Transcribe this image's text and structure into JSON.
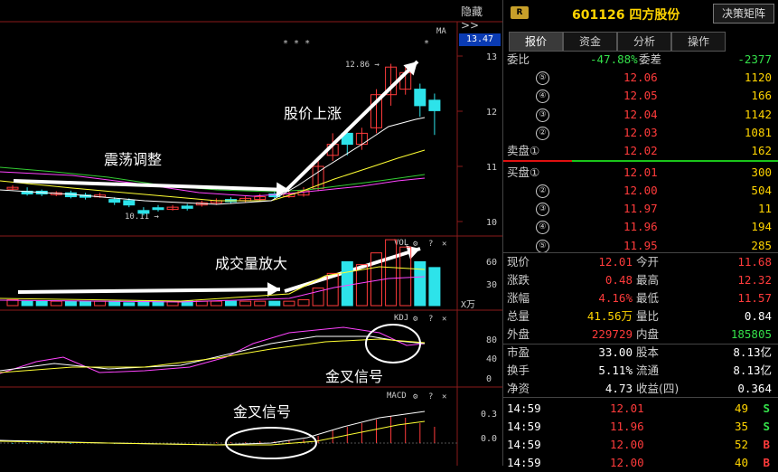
{
  "chart": {
    "hide_label": "隐藏>>",
    "ma_label": "MA",
    "price_tag": "13.47",
    "price_axis": [
      "13",
      "12",
      "11",
      "10"
    ],
    "high_label": "12.86",
    "low_label": "10.11",
    "stars": "* * *",
    "star_right": "*",
    "vol_label": "VOL",
    "vol_axis": [
      "60",
      "30"
    ],
    "vol_unit": "X万",
    "kdj_label": "KDJ",
    "kdj_axis": [
      "80",
      "40",
      "0"
    ],
    "macd_label": "MACD",
    "macd_axis": [
      "0.3",
      "0.0"
    ],
    "annotations": {
      "oscillation": "震荡调整",
      "rise": "股价上涨",
      "volume": "成交量放大",
      "golden_cross_kdj": "金叉信号",
      "golden_cross_macd": "金叉信号"
    },
    "colors": {
      "up": "#ff3b3b",
      "down": "#2de3ea",
      "ma5": "#ffffff",
      "ma10": "#ffff33",
      "ma20": "#ff44ff",
      "ma60": "#33cc33"
    }
  },
  "header": {
    "badge": "R",
    "code_name": "601126 四方股份",
    "decision_button": "决策矩阵"
  },
  "tabs": [
    "报价",
    "资金",
    "分析",
    "操作"
  ],
  "order_book": {
    "weibi_label": "委比",
    "weibi_value": "-47.88%",
    "weicha_label": "委差",
    "weicha_value": "-2377",
    "asks": [
      {
        "label": "⑤",
        "price": "12.06",
        "vol": "1120"
      },
      {
        "label": "④",
        "price": "12.05",
        "vol": "166"
      },
      {
        "label": "③",
        "price": "12.04",
        "vol": "1142"
      },
      {
        "label": "②",
        "price": "12.03",
        "vol": "1081"
      },
      {
        "label": "卖盘①",
        "price": "12.02",
        "vol": "162"
      }
    ],
    "bids": [
      {
        "label": "买盘①",
        "price": "12.01",
        "vol": "300"
      },
      {
        "label": "②",
        "price": "12.00",
        "vol": "504"
      },
      {
        "label": "③",
        "price": "11.97",
        "vol": "11"
      },
      {
        "label": "④",
        "price": "11.96",
        "vol": "194"
      },
      {
        "label": "⑤",
        "price": "11.95",
        "vol": "285"
      }
    ]
  },
  "stats": [
    {
      "l1": "现价",
      "v1": "12.01",
      "c1": "red",
      "l2": "今开",
      "v2": "11.68",
      "c2": "red"
    },
    {
      "l1": "涨跌",
      "v1": "0.48",
      "c1": "red",
      "l2": "最高",
      "v2": "12.32",
      "c2": "red"
    },
    {
      "l1": "涨幅",
      "v1": "4.16%",
      "c1": "red",
      "l2": "最低",
      "v2": "11.57",
      "c2": "red"
    },
    {
      "l1": "总量",
      "v1": "41.56万",
      "c1": "yellow",
      "l2": "量比",
      "v2": "0.84",
      "c2": "white"
    },
    {
      "l1": "外盘",
      "v1": "229729",
      "c1": "red",
      "l2": "内盘",
      "v2": "185805",
      "c2": "green"
    },
    {
      "l1": "市盈",
      "v1": "33.00",
      "c1": "white",
      "l2": "股本",
      "v2": "8.13亿",
      "c2": "white"
    },
    {
      "l1": "换手",
      "v1": "5.11%",
      "c1": "white",
      "l2": "流通",
      "v2": "8.13亿",
      "c2": "white"
    },
    {
      "l1": "净资",
      "v1": "4.73",
      "c1": "white",
      "l2": "收益(四)",
      "v2": "0.364",
      "c2": "white"
    }
  ],
  "ticks": [
    {
      "time": "14:59",
      "price": "12.01",
      "vol": "49",
      "side": "S"
    },
    {
      "time": "14:59",
      "price": "11.96",
      "vol": "35",
      "side": "S"
    },
    {
      "time": "14:59",
      "price": "12.00",
      "vol": "52",
      "side": "B"
    },
    {
      "time": "14:59",
      "price": "12.00",
      "vol": "40",
      "side": "B"
    }
  ]
}
